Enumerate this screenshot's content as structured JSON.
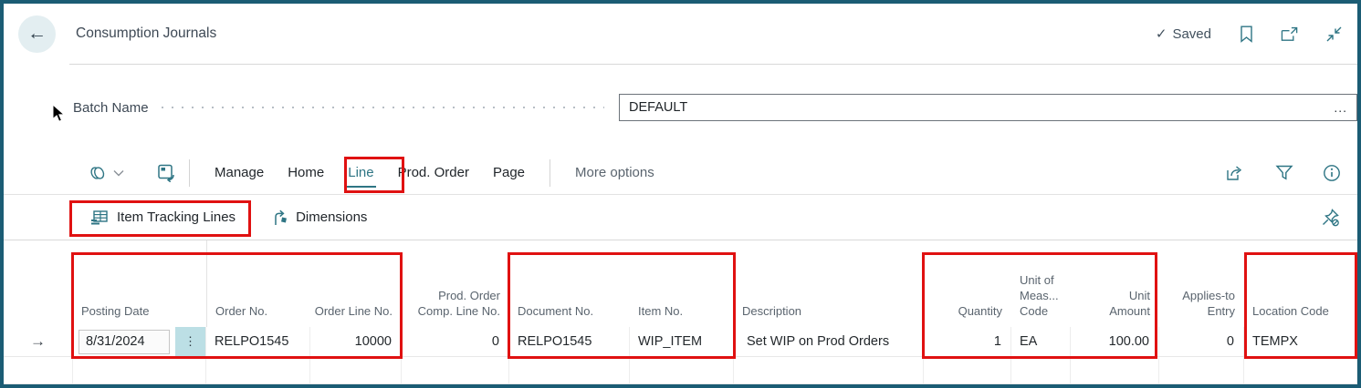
{
  "colors": {
    "frame": "#1b5c74",
    "accent_teal": "#2e7584",
    "annotation_red": "#e01111",
    "assist_cell_bg": "#bcdfe5"
  },
  "header": {
    "title": "Consumption Journals",
    "saved_label": "Saved"
  },
  "batch": {
    "label": "Batch Name",
    "value": "DEFAULT",
    "ellipsis_label": "..."
  },
  "ribbon": {
    "tabs": [
      {
        "label": "Manage"
      },
      {
        "label": "Home"
      },
      {
        "label": "Line",
        "active": true
      },
      {
        "label": "Prod. Order"
      },
      {
        "label": "Page"
      }
    ],
    "more_options_label": "More options"
  },
  "actions": {
    "item_tracking_label": "Item Tracking Lines",
    "dimensions_label": "Dimensions"
  },
  "table": {
    "columns": [
      "Posting Date",
      "Order No.",
      "Order Line No.",
      "Prod. Order Comp. Line No.",
      "Document No.",
      "Item No.",
      "Description",
      "Quantity",
      "Unit of Meas... Code",
      "Unit Amount",
      "Applies-to Entry",
      "Location Code"
    ],
    "row": {
      "posting_date": "8/31/2024",
      "order_no": "RELPO1545",
      "order_line_no": "10000",
      "prod_order_comp_line_no": "0",
      "document_no": "RELPO1545",
      "item_no": "WIP_ITEM",
      "description": "Set WIP on Prod Orders",
      "quantity": "1",
      "unit_of_measure_code": "EA",
      "unit_amount": "100.00",
      "applies_to_entry": "0",
      "location_code": "TEMPX"
    }
  },
  "glyphs": {
    "back_arrow": "←",
    "saved_check": "✓",
    "row_selector_arrow": "→",
    "assist_menu": "⋮"
  }
}
